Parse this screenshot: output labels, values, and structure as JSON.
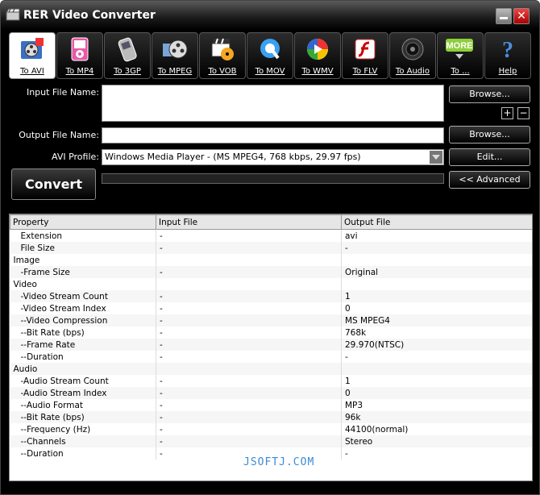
{
  "window": {
    "title": "RER Video Converter",
    "close_glyph": "✕"
  },
  "toolbar": {
    "buttons": [
      {
        "label": "To AVI",
        "icon": "film-reel-icon"
      },
      {
        "label": "To MP4",
        "icon": "mp4-player-icon"
      },
      {
        "label": "To 3GP",
        "icon": "mobile-phone-icon"
      },
      {
        "label": "To MPEG",
        "icon": "mpeg-film-icon"
      },
      {
        "label": "To VOB",
        "icon": "dvd-clapper-icon"
      },
      {
        "label": "To MOV",
        "icon": "quicktime-icon"
      },
      {
        "label": "To WMV",
        "icon": "windows-media-icon"
      },
      {
        "label": "To FLV",
        "icon": "flash-icon"
      },
      {
        "label": "To Audio",
        "icon": "speaker-icon"
      },
      {
        "label": "To ...",
        "icon": "more-icon",
        "icon_text": "MORE"
      },
      {
        "label": "Help",
        "icon": "help-icon",
        "icon_text": "?"
      }
    ]
  },
  "form": {
    "input_label": "Input File Name:",
    "input_value": "",
    "output_label": "Output File Name:",
    "output_value": "",
    "profile_label": "AVI Profile:",
    "profile_value": "Windows Media Player - (MS MPEG4, 768 kbps, 29.97 fps)",
    "browse_label": "Browse...",
    "browse2_label": "Browse...",
    "edit_label": "Edit...",
    "advanced_label": "<< Advanced",
    "convert_label": "Convert",
    "add_glyph": "+",
    "remove_glyph": "−"
  },
  "properties": {
    "headers": [
      "Property",
      "Input File",
      "Output File"
    ],
    "rows": [
      [
        "Extension",
        "-",
        "avi"
      ],
      [
        "File Size",
        "-",
        "-"
      ],
      [
        "Image",
        "",
        ""
      ],
      [
        "-Frame Size",
        "-",
        "Original"
      ],
      [
        "Video",
        "",
        ""
      ],
      [
        "-Video Stream Count",
        "-",
        "1"
      ],
      [
        "-Video Stream Index",
        "-",
        "0"
      ],
      [
        "--Video Compression",
        "-",
        "MS MPEG4"
      ],
      [
        "--Bit Rate (bps)",
        "-",
        "768k"
      ],
      [
        "--Frame Rate",
        "-",
        "29.970(NTSC)"
      ],
      [
        "--Duration",
        "-",
        "-"
      ],
      [
        "Audio",
        "",
        ""
      ],
      [
        "-Audio Stream Count",
        "-",
        "1"
      ],
      [
        "-Audio Stream Index",
        "-",
        "0"
      ],
      [
        "--Audio Format",
        "-",
        "MP3"
      ],
      [
        "--Bit Rate (bps)",
        "-",
        "96k"
      ],
      [
        "--Frequency (Hz)",
        "-",
        "44100(normal)"
      ],
      [
        "--Channels",
        "-",
        "Stereo"
      ],
      [
        "--Duration",
        "-",
        "-"
      ]
    ]
  },
  "watermark": "JSOFTJ.COM"
}
